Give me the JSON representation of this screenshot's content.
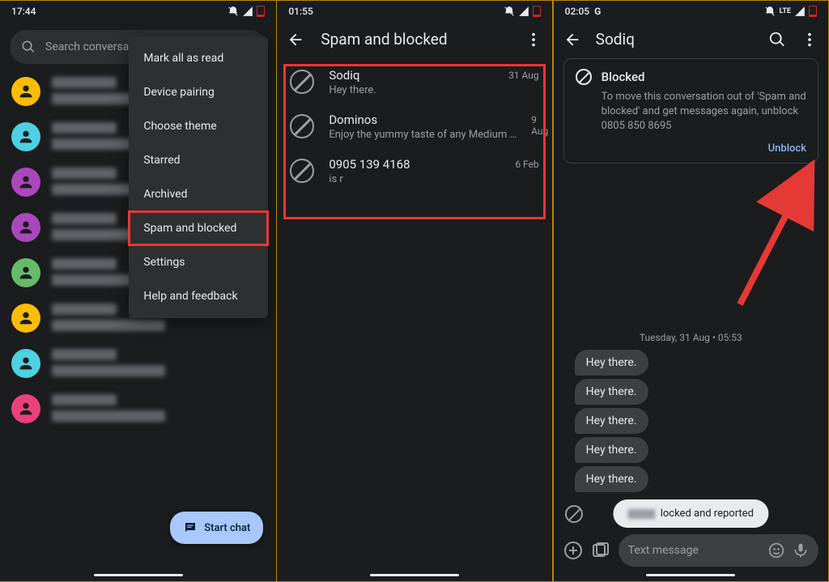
{
  "screen1": {
    "time": "17:44",
    "search_placeholder": "Search conversat",
    "menu": {
      "items": [
        {
          "label": "Mark all as read"
        },
        {
          "label": "Device pairing"
        },
        {
          "label": "Choose theme"
        },
        {
          "label": "Starred"
        },
        {
          "label": "Archived"
        },
        {
          "label": "Spam and blocked",
          "highlighted": true
        },
        {
          "label": "Settings"
        },
        {
          "label": "Help and feedback"
        }
      ]
    },
    "avatar_colors": [
      "#fbbc04",
      "#4dd0e1",
      "#ab47bc",
      "#ab47bc",
      "#66bb6a",
      "#fbbc04",
      "#4dd0e1",
      "#ec407a"
    ],
    "fab_label": "Start chat"
  },
  "screen2": {
    "time": "01:55",
    "title": "Spam and blocked",
    "rows": [
      {
        "title": "Sodiq",
        "sub": "Hey there.",
        "date": "31 Aug"
      },
      {
        "title": "Dominos",
        "sub": "Enjoy the yummy taste of any Medium …",
        "date": "9 Aug"
      },
      {
        "title": "0905 139 4168",
        "sub": "is r",
        "date": "6 Feb"
      }
    ]
  },
  "screen3": {
    "time": "02:05",
    "g_label": "G",
    "title": "Sodiq",
    "card": {
      "title": "Blocked",
      "body": "To move this conversation out of 'Spam and blocked' and get messages again, unblock 0805 850 8695",
      "unblock_label": "Unblock"
    },
    "date_separator": "Tuesday, 31 Aug • 05:53",
    "bubbles": [
      "Hey there.",
      "Hey there.",
      "Hey there.",
      "Hey there.",
      "Hey there."
    ],
    "toast_suffix": "locked and reported",
    "composer_placeholder": "Text message"
  }
}
